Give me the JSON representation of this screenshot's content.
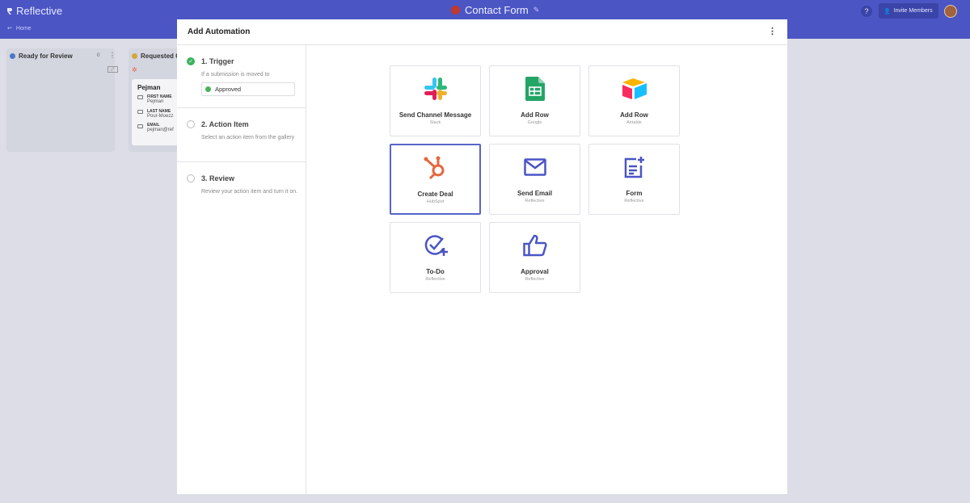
{
  "topbar": {
    "brand": "Reflective",
    "page_title": "Contact Form",
    "help": "?",
    "invite_label": "Invite Members",
    "home_label": "Home"
  },
  "board": {
    "columns": [
      {
        "title": "Ready for Review",
        "count": "0",
        "color": "#4a78c8"
      },
      {
        "title": "Requested C",
        "color": "#d4a53a"
      }
    ],
    "card": {
      "name": "Pejman",
      "fields": [
        {
          "label": "FIRST NAME",
          "value": "Pejman"
        },
        {
          "label": "LAST NAME",
          "value": "Pour-Moezz"
        },
        {
          "label": "EMAIL",
          "value": "pejman@ref"
        }
      ]
    }
  },
  "modal": {
    "title": "Add Automation",
    "steps": [
      {
        "title": "1. Trigger",
        "desc": "If a submission is moved to",
        "status": "Approved",
        "state": "done"
      },
      {
        "title": "2. Action Item",
        "desc": "Select an action item from the gallery",
        "state": "todo"
      },
      {
        "title": "3. Review",
        "desc": "Review your action item and turn it on.",
        "state": "todo"
      }
    ],
    "tiles": [
      {
        "label": "Send Channel Message",
        "sub": "Slack",
        "icon": "slack-icon"
      },
      {
        "label": "Add Row",
        "sub": "Google",
        "icon": "google-sheets-icon"
      },
      {
        "label": "Add Row",
        "sub": "Airtable",
        "icon": "airtable-icon"
      },
      {
        "label": "Create Deal",
        "sub": "HubSpot",
        "icon": "hubspot-icon",
        "selected": true
      },
      {
        "label": "Send Email",
        "sub": "Reflective",
        "icon": "mail-icon"
      },
      {
        "label": "Form",
        "sub": "Reflective",
        "icon": "form-icon"
      },
      {
        "label": "To-Do",
        "sub": "Reflective",
        "icon": "todo-check-icon"
      },
      {
        "label": "Approval",
        "sub": "Reflective",
        "icon": "thumbs-up-icon"
      }
    ]
  },
  "colors": {
    "topbar": "#4b55c4",
    "accent": "#5864c7",
    "success": "#3bb25a",
    "hubspot": "#e5673f"
  }
}
